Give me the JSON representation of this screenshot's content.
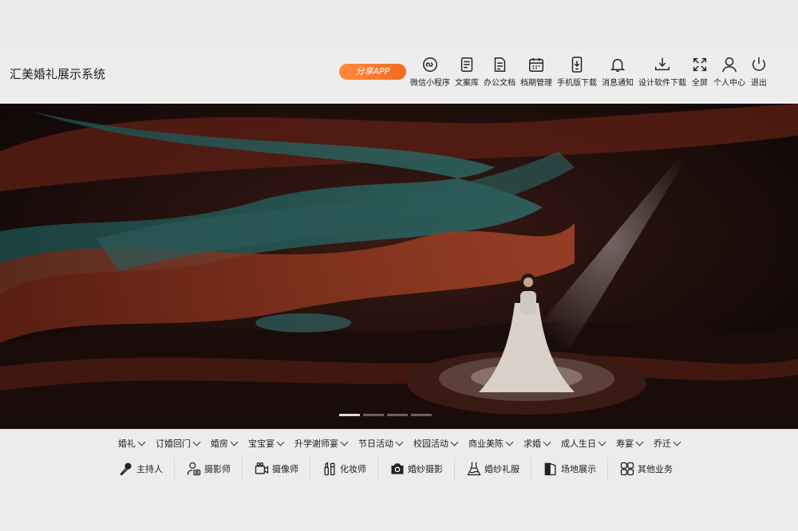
{
  "header": {
    "title": "汇美婚礼展示系统",
    "share_label": "分享APP",
    "nav": [
      {
        "label": "微信小程序",
        "icon": "wechat-miniprogram-icon"
      },
      {
        "label": "文案库",
        "icon": "document-library-icon"
      },
      {
        "label": "办公文档",
        "icon": "office-document-icon"
      },
      {
        "label": "档期管理",
        "icon": "calendar-icon"
      },
      {
        "label": "手机版下载",
        "icon": "phone-download-icon"
      },
      {
        "label": "消息通知",
        "icon": "bell-icon"
      },
      {
        "label": "设计软件下载",
        "icon": "download-tray-icon"
      },
      {
        "label": "全屏",
        "icon": "fullscreen-icon"
      },
      {
        "label": "个人中心",
        "icon": "user-icon"
      },
      {
        "label": "退出",
        "icon": "power-icon"
      }
    ]
  },
  "hero": {
    "slide_count": 4,
    "active_slide": 1
  },
  "categories": [
    "婚礼",
    "订婚回门",
    "婚房",
    "宝宝宴",
    "升学谢师宴",
    "节日活动",
    "校园活动",
    "商业美陈",
    "求婚",
    "成人生日",
    "寿宴",
    "乔迁"
  ],
  "services": [
    {
      "label": "主持人",
      "icon": "microphone-icon"
    },
    {
      "label": "摄影师",
      "icon": "photographer-icon"
    },
    {
      "label": "摄像师",
      "icon": "video-camera-icon"
    },
    {
      "label": "化妆师",
      "icon": "makeup-icon"
    },
    {
      "label": "婚纱摄影",
      "icon": "camera-icon"
    },
    {
      "label": "婚纱礼服",
      "icon": "wedding-dress-icon"
    },
    {
      "label": "场地展示",
      "icon": "venue-icon"
    },
    {
      "label": "其他业务",
      "icon": "grid-icon"
    }
  ],
  "colors": {
    "accent": "#f36a1f",
    "hero_bg": "#120a0a"
  }
}
